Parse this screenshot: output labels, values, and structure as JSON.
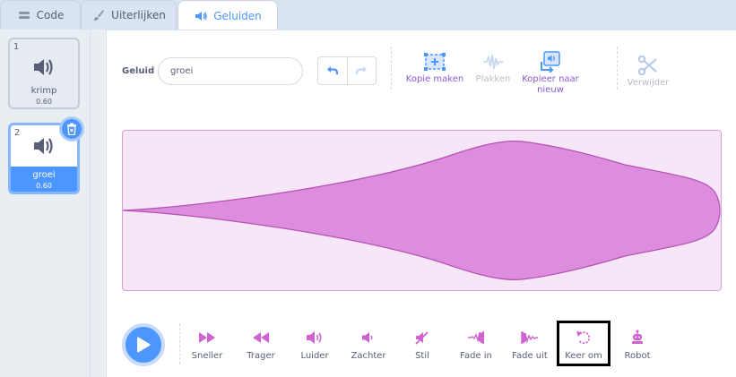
{
  "tabs": [
    {
      "label": "Code",
      "icon": "code-icon"
    },
    {
      "label": "Uiterlijken",
      "icon": "paintbrush-icon"
    },
    {
      "label": "Geluiden",
      "icon": "speaker-icon",
      "active": true
    }
  ],
  "sounds": [
    {
      "number": "1",
      "name": "krimp",
      "duration": "0.60"
    },
    {
      "number": "2",
      "name": "groei",
      "duration": "0.60",
      "selected": true
    }
  ],
  "editor": {
    "name_label": "Geluid",
    "name_value": "groei",
    "tools": {
      "copy": "Kopie maken",
      "paste": "Plakken",
      "copy_new": "Kopieer naar nieuw",
      "delete": "Verwijder"
    }
  },
  "effects": [
    {
      "label": "Sneller",
      "icon": "fast-forward-icon"
    },
    {
      "label": "Trager",
      "icon": "rewind-icon"
    },
    {
      "label": "Luider",
      "icon": "louder-icon"
    },
    {
      "label": "Zachter",
      "icon": "softer-icon"
    },
    {
      "label": "Stil",
      "icon": "mute-icon"
    },
    {
      "label": "Fade in",
      "icon": "fade-in-icon"
    },
    {
      "label": "Fade uit",
      "icon": "fade-out-icon"
    },
    {
      "label": "Keer om",
      "icon": "reverse-icon",
      "highlighted": true
    },
    {
      "label": "Robot",
      "icon": "robot-icon"
    }
  ],
  "colors": {
    "accent": "#4c97ff",
    "effect_purple": "#855cd6",
    "wave_fill": "#cf63cf",
    "wave_bg": "#f7e6f7"
  }
}
